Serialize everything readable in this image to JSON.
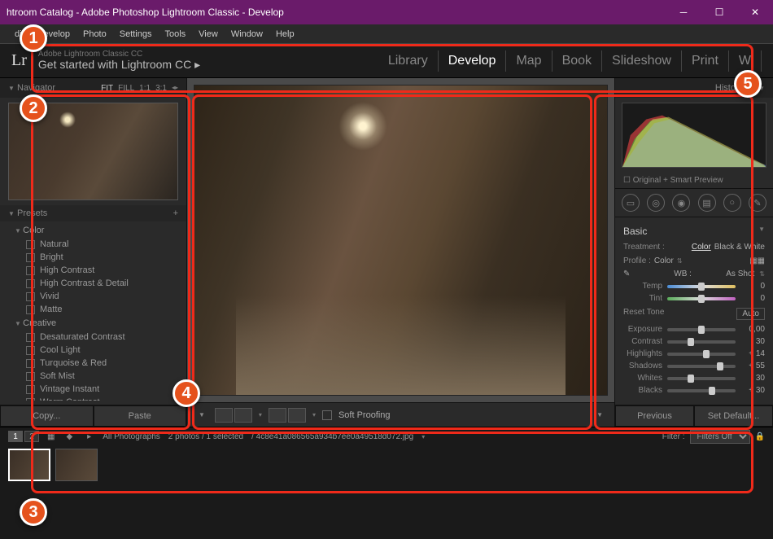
{
  "window": {
    "title": "htroom Catalog - Adobe Photoshop Lightroom Classic - Develop"
  },
  "menu": [
    "dit",
    "Develop",
    "Photo",
    "Settings",
    "Tools",
    "View",
    "Window",
    "Help"
  ],
  "header": {
    "logo": "Lr",
    "sub1": "Adobe Lightroom Classic CC",
    "sub2": "Get started with Lightroom CC ▸"
  },
  "modules": [
    "Library",
    "Develop",
    "Map",
    "Book",
    "Slideshow",
    "Print",
    "W"
  ],
  "active_module": "Develop",
  "navigator": {
    "title": "Navigator",
    "opts": [
      "FIT",
      "FILL",
      "1:1",
      "3:1"
    ],
    "active_opt": "FIT"
  },
  "presets": {
    "title": "Presets",
    "groups": [
      {
        "name": "Color",
        "items": [
          "Natural",
          "Bright",
          "High Contrast",
          "High Contrast & Detail",
          "Vivid",
          "Matte"
        ]
      },
      {
        "name": "Creative",
        "items": [
          "Desaturated Contrast",
          "Cool Light",
          "Turquoise & Red",
          "Soft Mist",
          "Vintage Instant",
          "Warm Contrast"
        ]
      }
    ]
  },
  "left_buttons": {
    "copy": "Copy...",
    "paste": "Paste"
  },
  "toolbar": {
    "soft_proofing": "Soft Proofing"
  },
  "histogram": {
    "title": "Histogram",
    "original": "Original + Smart Preview"
  },
  "basic": {
    "title": "Basic",
    "treatment_label": "Treatment :",
    "color": "Color",
    "bw": "Black & White",
    "profile_label": "Profile :",
    "profile_value": "Color",
    "wb_label": "WB :",
    "wb_value": "As Shot",
    "temp_label": "Temp",
    "temp_val": "0",
    "tint_label": "Tint",
    "tint_val": "0",
    "reset": "Reset Tone",
    "auto": "Auto",
    "sliders": [
      {
        "label": "Exposure",
        "val": "0,00",
        "pos": 50
      },
      {
        "label": "Contrast",
        "val": "- 30",
        "pos": 35
      },
      {
        "label": "Highlights",
        "val": "+ 14",
        "pos": 57
      },
      {
        "label": "Shadows",
        "val": "+ 55",
        "pos": 77
      },
      {
        "label": "Whites",
        "val": "- 30",
        "pos": 35
      },
      {
        "label": "Blacks",
        "val": "+ 30",
        "pos": 65
      }
    ]
  },
  "right_buttons": {
    "prev": "Previous",
    "reset": "Set Default..."
  },
  "filmstrip": {
    "source": "All Photographs",
    "count": "2 photos / 1 selected",
    "filename": "/ 4c8e41a086565a934b7ee0a49518d072.jpg",
    "filter_label": "Filter :",
    "filter_value": "Filters Off"
  },
  "badges": [
    "1",
    "2",
    "3",
    "4",
    "5"
  ]
}
